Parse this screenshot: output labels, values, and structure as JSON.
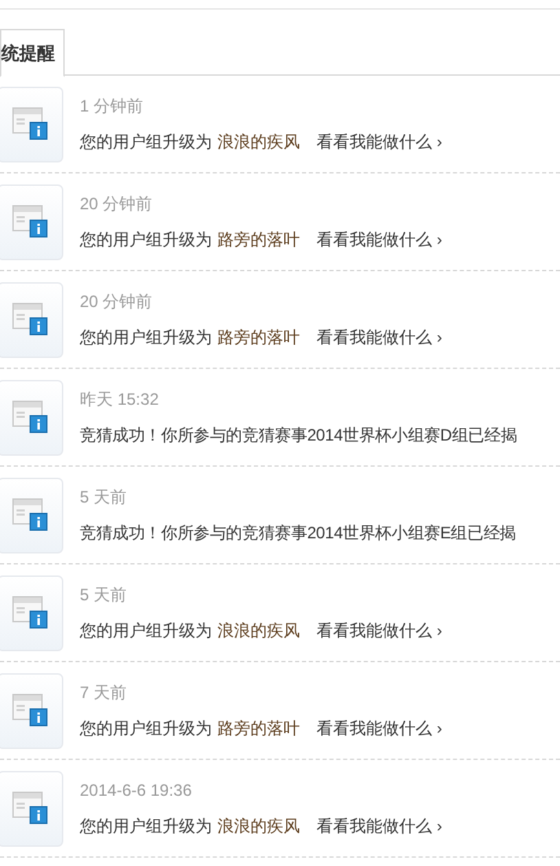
{
  "tabs": [
    {
      "label": "统提醒",
      "selected": true
    }
  ],
  "notices": [
    {
      "kind": "upgrade",
      "time": "1 分钟前",
      "text": "您的用户组升级为",
      "group": "浪浪的疾风",
      "link": "看看我能做什么 ›"
    },
    {
      "kind": "upgrade",
      "time": "20 分钟前",
      "text": "您的用户组升级为",
      "group": "路旁的落叶",
      "link": "看看我能做什么 ›"
    },
    {
      "kind": "upgrade",
      "time": "20 分钟前",
      "text": "您的用户组升级为",
      "group": "路旁的落叶",
      "link": "看看我能做什么 ›"
    },
    {
      "kind": "guess",
      "time": "昨天 15:32",
      "text": "竞猜成功！你所参与的竞猜赛事2014世界杯小组赛D组已经揭"
    },
    {
      "kind": "guess",
      "time": "5 天前",
      "text": "竞猜成功！你所参与的竞猜赛事2014世界杯小组赛E组已经揭"
    },
    {
      "kind": "upgrade",
      "time": "5 天前",
      "text": "您的用户组升级为",
      "group": "浪浪的疾风",
      "link": "看看我能做什么 ›"
    },
    {
      "kind": "upgrade",
      "time": "7 天前",
      "text": "您的用户组升级为",
      "group": "路旁的落叶",
      "link": "看看我能做什么 ›"
    },
    {
      "kind": "upgrade",
      "time": "2014-6-6 19:36",
      "text": "您的用户组升级为",
      "group": "浪浪的疾风",
      "link": "看看我能做什么 ›"
    }
  ]
}
